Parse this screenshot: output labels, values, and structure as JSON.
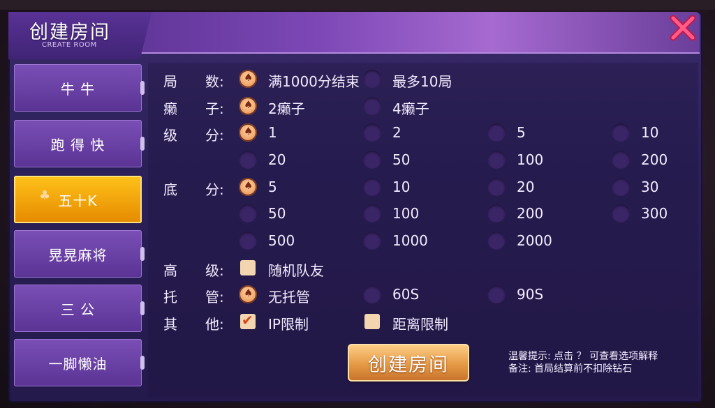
{
  "header": {
    "title": "创建房间",
    "subtitle": "CREATE ROOM"
  },
  "sidebar": {
    "items": [
      {
        "label": "牛      牛",
        "active": false
      },
      {
        "label": "跑   得   快",
        "active": false
      },
      {
        "label": "五十K",
        "active": true
      },
      {
        "label": "晃晃麻将",
        "active": false
      },
      {
        "label": "三    公",
        "active": false
      },
      {
        "label": "一脚懒油",
        "active": false
      }
    ]
  },
  "form": {
    "rounds": {
      "label_a": "局",
      "label_b": "数:",
      "options": [
        "满1000分结束",
        "最多10局"
      ],
      "selected": 0
    },
    "wild": {
      "label_a": "癞",
      "label_b": "子:",
      "options": [
        "2癞子",
        "4癞子"
      ],
      "selected": 0
    },
    "level": {
      "label_a": "级",
      "label_b": "分:",
      "options": [
        "1",
        "2",
        "5",
        "10",
        "20",
        "50",
        "100",
        "200"
      ],
      "selected": 0
    },
    "base": {
      "label_a": "底",
      "label_b": "分:",
      "options": [
        "5",
        "10",
        "20",
        "30",
        "50",
        "100",
        "200",
        "300",
        "500",
        "1000",
        "2000"
      ],
      "selected": 0
    },
    "advanced": {
      "label_a": "高",
      "label_b": "级:",
      "options": [
        "随机队友"
      ],
      "checked": [
        false
      ]
    },
    "managed": {
      "label_a": "托",
      "label_b": "管:",
      "options": [
        "无托管",
        "60S",
        "90S"
      ],
      "selected": 0
    },
    "other": {
      "label_a": "其",
      "label_b": "他:",
      "options": [
        "IP限制",
        "距离限制"
      ],
      "checked": [
        true,
        false
      ]
    }
  },
  "create_button": "创建房间",
  "tips": {
    "line1": "温馨提示: 点击 ？ 可查看选项解释",
    "line2": "备注: 首局结算前不扣除钻石"
  },
  "colors": {
    "accent": "#f0a56a",
    "active_tab": "#ffc21a",
    "panel": "#2b2058"
  }
}
